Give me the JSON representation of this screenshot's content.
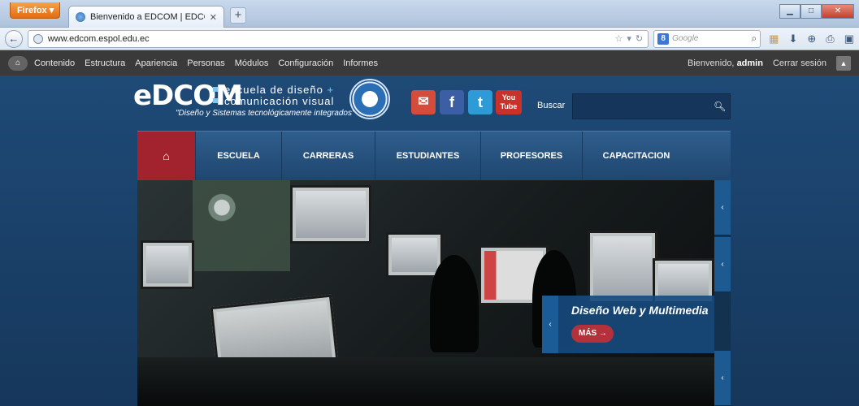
{
  "browser": {
    "menu_button": "Firefox",
    "tab_title": "Bienvenido a EDCOM | EDCOM",
    "url": "www.edcom.espol.edu.ec",
    "search_engine": "Google",
    "search_badge": "8"
  },
  "admin_toolbar": {
    "items": [
      "Contenido",
      "Estructura",
      "Apariencia",
      "Personas",
      "Módulos",
      "Configuración",
      "Informes"
    ],
    "welcome_prefix": "Bienvenido,",
    "username": "admin",
    "logout": "Cerrar sesión"
  },
  "site": {
    "logo_text": "eDCOM",
    "logo_line1": "escuela de diseño",
    "logo_plus": "+",
    "logo_line2": "comunicación visual",
    "tagline": "\"Diseño y Sistemas tecnológicamente integrados\"",
    "social": {
      "facebook": "f",
      "twitter": "t",
      "youtube": "You Tube"
    },
    "search_label": "Buscar"
  },
  "main_menu": [
    "ESCUELA",
    "CARRERAS",
    "ESTUDIANTES",
    "PROFESORES",
    "CAPACITACION"
  ],
  "slider": {
    "caption_title": "Diseño Web y Multimedia",
    "button_label": "MÁS"
  },
  "colors": {
    "site_background": "#1e4a77",
    "menu_home_active": "#a2232e",
    "button_accent": "#b3313b",
    "admin_bar": "#3a3a3a"
  }
}
